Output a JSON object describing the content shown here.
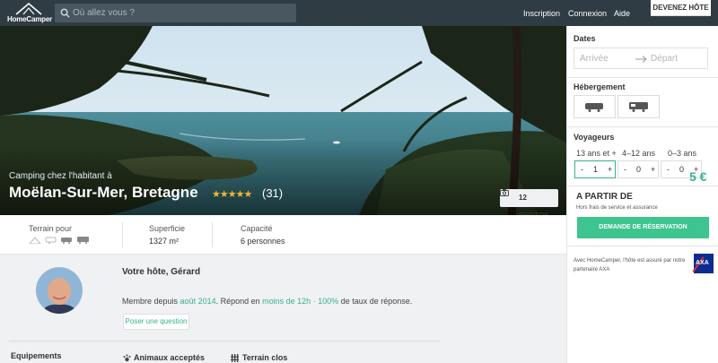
{
  "topbar": {
    "logo_text": "HomeCamper",
    "search_placeholder": "Où allez vous ?",
    "nav": [
      "Inscription",
      "Connexion",
      "Aide"
    ],
    "host_cta": "DEVENEZ HÔTE"
  },
  "hero": {
    "kicker": "Camping chez l'habitant à",
    "title": "Moëlan-Sur-Mer, Bretagne",
    "stars": "★★★★★",
    "rating": 5,
    "reviews": "(31)",
    "photos_button": "12 PHOTOS"
  },
  "stats": {
    "terrain_label": "Terrain pour",
    "surface_label": "Superficie",
    "surface_value": "1327 m²",
    "capacity_label": "Capacité",
    "capacity_value": "6 personnes"
  },
  "host": {
    "title": "Votre hôte, Gérard",
    "member_prefix": "Membre depuis",
    "member_date": "août 2014",
    "responds_prefix": ". Répond en",
    "response_time": "moins de 12h",
    "separator": " · ",
    "response_rate": "100%",
    "rate_suffix": "de taux de réponse.",
    "ask_button": "Poser une question",
    "equipments_title": "Equipements",
    "amenities": [
      "Animaux acceptés",
      "Terrain clos"
    ]
  },
  "sidebar": {
    "dates_title": "Dates",
    "date_in_placeholder": "Arrivée",
    "date_out_placeholder": "Départ",
    "lodging_title": "Hébergement",
    "travelers_title": "Voyageurs",
    "age_groups": [
      {
        "label": "13 ans et +",
        "value": "1"
      },
      {
        "label": "4–12 ans",
        "value": "0"
      },
      {
        "label": "0–3 ans",
        "value": "0"
      }
    ],
    "price_label": "A PARTIR DE",
    "price_note": "Hors frais de service et assurance",
    "price_value": "5 €",
    "book_button": "DEMANDE DE RÉSERVATION",
    "axa_note": "Avec HomeCamper, l'hôte est assuré par notre partenaire AXA",
    "axa_logo": "AXA"
  },
  "colors": {
    "accent": "#3ec48f",
    "topbar": "#2f3c44",
    "star": "#f2b631"
  }
}
